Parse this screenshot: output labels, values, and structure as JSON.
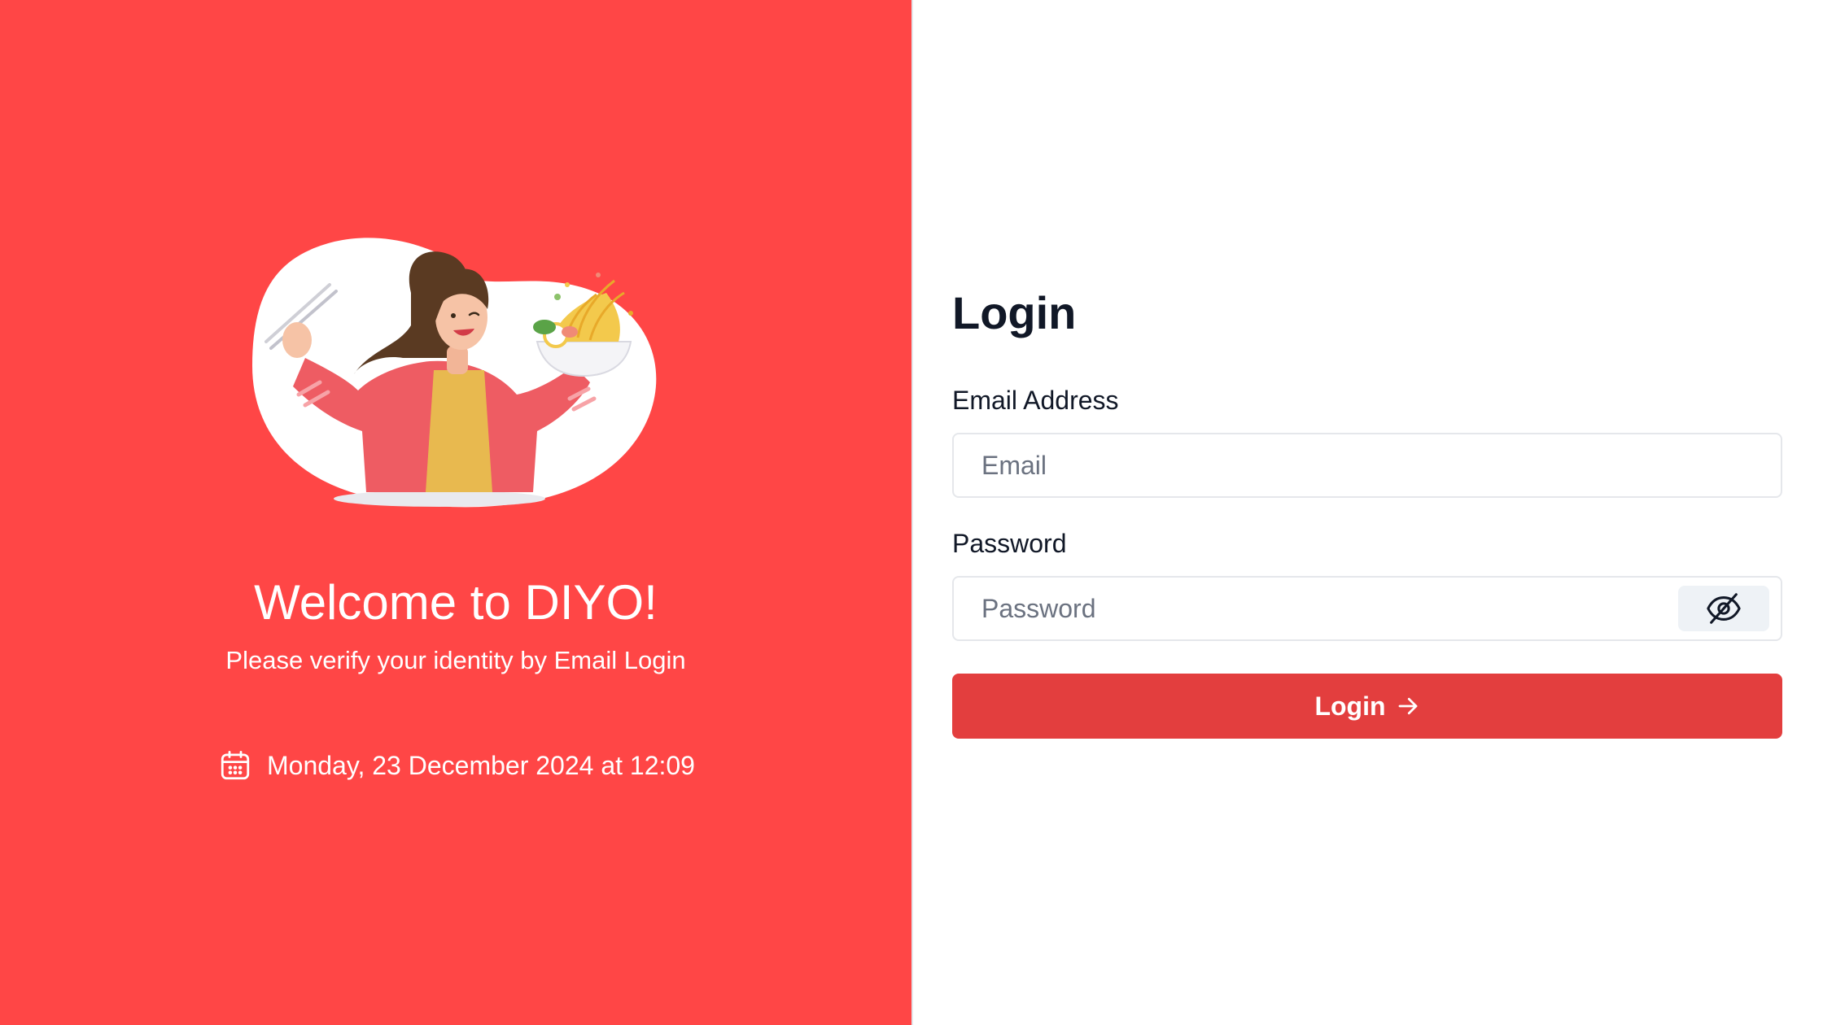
{
  "left": {
    "hero_image": "woman-holding-chopsticks-and-noodle-bowl-illustration",
    "welcome_title": "Welcome to DIYO!",
    "welcome_subtitle": "Please verify your identity by Email Login",
    "datetime_icon": "calendar-icon",
    "datetime": "Monday, 23 December 2024 at 12:09"
  },
  "login": {
    "title": "Login",
    "email": {
      "label": "Email Address",
      "placeholder": "Email",
      "value": ""
    },
    "password": {
      "label": "Password",
      "placeholder": "Password",
      "value": "",
      "toggle_icon": "eye-off-icon"
    },
    "submit_label": "Login",
    "submit_icon": "arrow-right-icon"
  },
  "colors": {
    "brand_red": "#ff4646",
    "button_red": "#e33e3e",
    "text_dark": "#111827",
    "placeholder_gray": "#6b7280",
    "border_gray": "#e5e7eb",
    "toggle_bg": "#eef2f6"
  }
}
